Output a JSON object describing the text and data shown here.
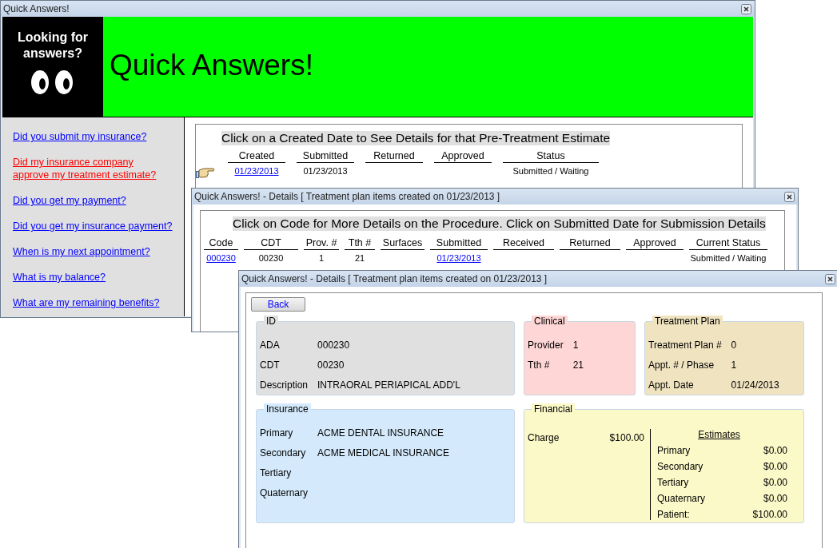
{
  "main_window": {
    "title": "Quick Answers!",
    "banner": {
      "tagline": "Looking for answers?",
      "title": "Quick Answers!"
    },
    "sidebar": {
      "links": [
        {
          "label": "Did you submit my insurance?",
          "selected": false
        },
        {
          "label": "Did my insurance company approve my treatment estimate?",
          "selected": true
        },
        {
          "label": "Did you get my payment?",
          "selected": false
        },
        {
          "label": "Did you get my insurance payment?",
          "selected": false
        },
        {
          "label": "When is my next appointment?",
          "selected": false
        },
        {
          "label": "What is my balance?",
          "selected": false
        },
        {
          "label": "What are my remaining benefits?",
          "selected": false
        }
      ]
    },
    "estimates": {
      "instruction": "Click on a Created Date to See Details for that Pre-Treatment Estimate",
      "columns": [
        "Created",
        "Submitted",
        "Returned",
        "Approved",
        "Status"
      ],
      "rows": [
        {
          "pointer": true,
          "cells": [
            {
              "text": "01/23/2013",
              "kind": "link"
            },
            {
              "text": "01/23/2013",
              "kind": "text"
            },
            null,
            null,
            {
              "text": "Submitted / Waiting",
              "kind": "text"
            }
          ]
        }
      ]
    }
  },
  "details_window": {
    "title": "Quick Answers! - Details [ Treatment plan items created on 01/23/2013 ]",
    "instruction": "Click on Code for More Details on the Procedure.  Click on Submitted Date for Submission Details",
    "columns": [
      "Code",
      "CDT",
      "Prov. #",
      "Tth #",
      "Surfaces",
      "Submitted",
      "Received",
      "Returned",
      "Approved",
      "Current Status"
    ],
    "rows": [
      {
        "cells": [
          {
            "text": "000230",
            "kind": "link"
          },
          {
            "text": "00230",
            "kind": "text"
          },
          {
            "text": "1",
            "kind": "text"
          },
          {
            "text": "21",
            "kind": "text"
          },
          null,
          {
            "text": "01/23/2013",
            "kind": "link"
          },
          null,
          null,
          null,
          {
            "text": "Submitted / Waiting",
            "kind": "text"
          }
        ]
      }
    ]
  },
  "procedure_window": {
    "title": "Quick Answers! - Details [ Treatment plan items created on 01/23/2013 ]",
    "back_button": "Back",
    "panel_rows": [
      [
        {
          "title": "ID",
          "kind": "fields",
          "color": "#e0e0e0",
          "fields": [
            {
              "label": "ADA",
              "value": "000230"
            },
            {
              "label": "CDT",
              "value": "00230"
            },
            {
              "label": "Description",
              "value": "INTRAORAL PERIAPICAL ADD'L"
            }
          ]
        },
        {
          "title": "Clinical",
          "kind": "fields",
          "color": "#ffd6d6",
          "fields": [
            {
              "label": "Provider",
              "value": "1"
            },
            {
              "label": "Tth #",
              "value": "21"
            }
          ]
        },
        {
          "title": "Treatment Plan",
          "kind": "fields",
          "color": "#f0e4c0",
          "fields": [
            {
              "label": "Treatment Plan #",
              "value": "0"
            },
            {
              "label": "Appt. # / Phase",
              "value": "1"
            },
            {
              "label": "Appt. Date",
              "value": "01/24/2013"
            }
          ]
        }
      ],
      [
        {
          "title": "Insurance",
          "kind": "fields",
          "color": "#d4eafc",
          "fields": [
            {
              "label": "Primary",
              "value": "ACME DENTAL INSURANCE"
            },
            {
              "label": "Secondary",
              "value": "ACME MEDICAL INSURANCE"
            },
            {
              "label": "Tertiary"
            },
            {
              "label": "Quaternary"
            }
          ]
        },
        {
          "title": "Financial",
          "kind": "financial",
          "color": "#fcf9c8",
          "charge": {
            "label": "Charge",
            "value": "$100.00"
          },
          "estimates_heading": "Estimates",
          "estimates": [
            {
              "label": "Primary",
              "value": "$0.00"
            },
            {
              "label": "Secondary",
              "value": "$0.00"
            },
            {
              "label": "Tertiary",
              "value": "$0.00"
            },
            {
              "label": "Quaternary",
              "value": "$0.00"
            },
            {
              "label": "Patient:",
              "value": "$100.00"
            }
          ]
        }
      ]
    ]
  }
}
